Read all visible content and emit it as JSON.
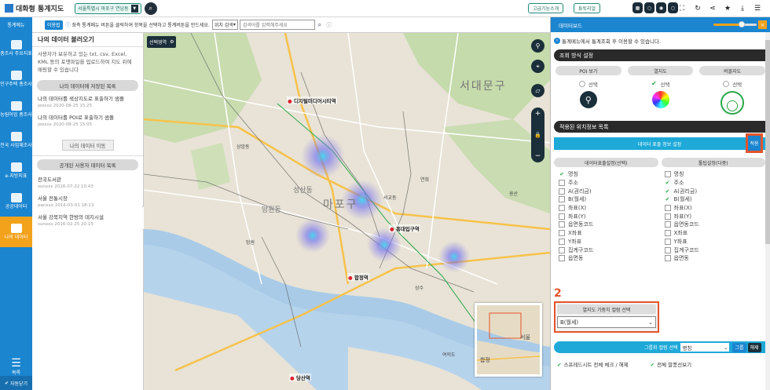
{
  "topbar": {
    "logo": "대화형 통계지도",
    "region": "서울특별시 마포구 연남동",
    "advanced_btn": "고급기능소개",
    "tutorial_btn": "튜토리얼"
  },
  "secondbar": {
    "menu_title": "통계메뉴",
    "usage_btn": "이용법",
    "info_text": "좌측 통계메뉴 버튼을 클릭하여 항목을 선택하고 통계버튼을 만드세요.",
    "location_select": "위치 검색",
    "search_placeholder": "검색어를 입력해주세요"
  },
  "leftnav": {
    "items": [
      {
        "label": "총조사 주요지표"
      },
      {
        "label": "인구주택 총조사"
      },
      {
        "label": "농림어업 총조사"
      },
      {
        "label": "전국 사업체조사"
      },
      {
        "label": "e-지방지표"
      },
      {
        "label": "공공데이터"
      },
      {
        "label": "나의 데이터"
      }
    ],
    "menu": "목록",
    "autoclose": "자동닫기"
  },
  "leftpanel": {
    "title": "나의 데이터 불러오기",
    "desc": "사용자가 보유하고 있는 txt, csv, Excel, KML 등의 포맷파일을 업로드하여 지도 위에 매핑할 수 있습니다",
    "saved_tab": "나의 데이터에 저장된 목록",
    "saved_items": [
      {
        "title": "나의 데이터를 색상지도로 표출하기 샘플",
        "meta": "jeoxxx 2020-08-25 15:25"
      },
      {
        "title": "나의 데이터를 POI로 표출하기 샘플",
        "meta": "jeoxxx 2020-08-25 15:05"
      }
    ],
    "move_btn": "나의 데이터 이동",
    "public_tab": "공개된 사용자 데이터 목록",
    "public_items": [
      {
        "title": "전국도서관",
        "meta": "sunxxx 2016-07-22 10:43"
      },
      {
        "title": "서울 전통시장",
        "meta": "panxxx 2016-03-01 18:13"
      },
      {
        "title": "서울 강북지역 한방의 데지시설",
        "meta": "sunxxx 2016-02-25 20:15"
      }
    ]
  },
  "map": {
    "select_area": "선택영역",
    "big_labels": [
      "서대문구",
      "마포구",
      "망원동",
      "성산동"
    ],
    "poi_labels": [
      "디지털미디어시티역",
      "홍대입구역",
      "합정역",
      "당산역"
    ],
    "small_labels": [
      "상암동",
      "연희",
      "서교동",
      "망원",
      "용산",
      "상수",
      "여의도",
      "서울",
      "합정"
    ]
  },
  "rightpanel": {
    "header": "데이터보드",
    "info": "통계메뉴에서 통계조회 후 이용할 수 있습니다.",
    "section1": "조회 방식 설정",
    "types": [
      {
        "label": "POI 보기",
        "radio": "선택",
        "selected": false
      },
      {
        "label": "열지도",
        "radio": "선택",
        "selected": true
      },
      {
        "label": "버블지도",
        "radio": "선택",
        "selected": false
      }
    ],
    "section2": "적용된 위치정보 목록",
    "display_setting": "데이터 표출 정보 설정",
    "apply_btn": "적용",
    "col1_head": "데이터표출설정(선택)",
    "col2_head": "툴팁설정(다중)",
    "col1_items": [
      {
        "label": "명칭",
        "checked": true
      },
      {
        "label": "주소",
        "checked": false
      },
      {
        "label": "A(권리금)",
        "checked": false
      },
      {
        "label": "B(월세)",
        "checked": false
      },
      {
        "label": "좌표(X)",
        "checked": false
      },
      {
        "label": "좌표(Y)",
        "checked": false
      },
      {
        "label": "읍면동코드",
        "checked": false
      },
      {
        "label": "X좌표",
        "checked": false
      },
      {
        "label": "Y좌표",
        "checked": false
      },
      {
        "label": "집계구코드",
        "checked": false
      },
      {
        "label": "읍면동",
        "checked": false
      }
    ],
    "col2_items": [
      {
        "label": "명칭",
        "checked": false
      },
      {
        "label": "주소",
        "checked": true
      },
      {
        "label": "A(권리금)",
        "checked": true
      },
      {
        "label": "B(월세)",
        "checked": true
      },
      {
        "label": "좌표(X)",
        "checked": false
      },
      {
        "label": "좌표(Y)",
        "checked": false
      },
      {
        "label": "읍면동코드",
        "checked": false
      },
      {
        "label": "X좌표",
        "checked": false
      },
      {
        "label": "Y좌표",
        "checked": false
      },
      {
        "label": "집계구코드",
        "checked": false
      },
      {
        "label": "읍면동",
        "checked": false
      }
    ],
    "step_number": "2",
    "heat_weight_title": "열지도 가중치 컬럼 선택",
    "heat_weight_value": "B(월세)",
    "group_label": "그룹화 컬럼 선택",
    "group_value": "명칭",
    "group_btn": "그룹",
    "release_btn": "해제",
    "footer_left": "스프레드시트 전체 체크 / 해제",
    "footer_right": "전체 말풍선보기"
  },
  "colors": {
    "nav_blue": "#1b85d0",
    "active_orange": "#f3a21c",
    "highlight_red": "#e3542c",
    "cyan_bar": "#1ea9d8"
  }
}
